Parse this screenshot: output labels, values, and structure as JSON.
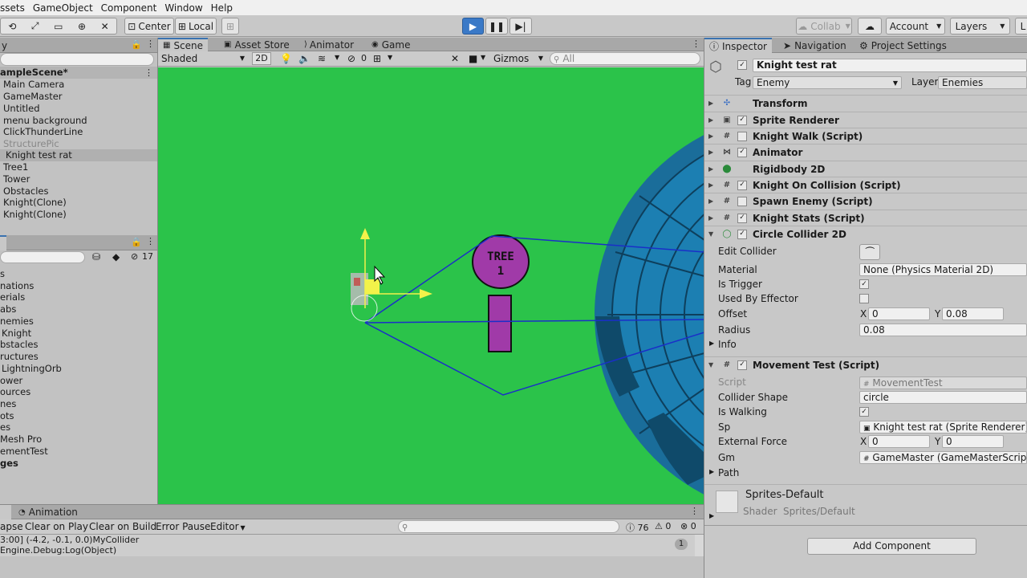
{
  "menubar": [
    "ssets",
    "GameObject",
    "Component",
    "Window",
    "Help"
  ],
  "toolbar": {
    "pivot": "Center",
    "space": "Local",
    "collab": "Collab",
    "account": "Account",
    "layers": "Layers",
    "layout": "L"
  },
  "hierarchy": {
    "tab_title": "y",
    "scene": "ampleScene*",
    "items": [
      "Main Camera",
      "GameMaster",
      "Untitled",
      "menu background",
      "ClickThunderLine",
      "StructurePic",
      "Knight test rat",
      "Tree1",
      "Tower",
      "Obstacles",
      "Knight(Clone)",
      "Knight(Clone)"
    ]
  },
  "project": {
    "count": "17",
    "items": [
      "s",
      "nations",
      "erials",
      "abs",
      "nemies",
      "Knight",
      "bstacles",
      "ructures",
      "LightningOrb",
      "ower",
      "ources",
      "nes",
      "ots",
      "es",
      "Mesh Pro",
      "ementTest",
      "ges"
    ]
  },
  "scene_view": {
    "tabs": [
      "Scene",
      "Asset Store",
      "Animator",
      "Game"
    ],
    "shading": "Shaded",
    "mode_2d": "2D",
    "hidden_count": "0",
    "gizmos": "Gizmos",
    "search_placeholder": "All",
    "tree_label_1": "TREE",
    "tree_label_2": "1",
    "background_color": "#2bc34a"
  },
  "console": {
    "tab": "Animation",
    "buttons": [
      "apse",
      "Clear on Play",
      "Clear on Build",
      "Error Pause",
      "Editor"
    ],
    "log_count": "76",
    "warn_count": "0",
    "error_count": "0",
    "line1": "3:00] (-4.2, -0.1, 0.0)MyCollider",
    "line2": "Engine.Debug:Log(Object)",
    "collapse_count": "1"
  },
  "inspector": {
    "tabs": [
      "Inspector",
      "Navigation",
      "Project Settings"
    ],
    "object_name": "Knight test rat",
    "tag_label": "Tag",
    "tag_value": "Enemy",
    "layer_label": "Layer",
    "layer_value": "Enemies",
    "components": [
      {
        "name": "Transform",
        "checkbox": "none"
      },
      {
        "name": "Sprite Renderer",
        "checkbox": "on"
      },
      {
        "name": "Knight Walk (Script)",
        "checkbox": "off"
      },
      {
        "name": "Animator",
        "checkbox": "on"
      },
      {
        "name": "Rigidbody 2D",
        "checkbox": "none"
      },
      {
        "name": "Knight On Collision (Script)",
        "checkbox": "on"
      },
      {
        "name": "Spawn Enemy (Script)",
        "checkbox": "off"
      },
      {
        "name": "Knight Stats (Script)",
        "checkbox": "on"
      },
      {
        "name": "Circle Collider 2D",
        "checkbox": "on"
      }
    ],
    "collider": {
      "edit_label": "Edit Collider",
      "material_label": "Material",
      "material_value": "None (Physics Material 2D)",
      "trigger_label": "Is Trigger",
      "effector_label": "Used By Effector",
      "offset_label": "Offset",
      "offset_x": "0",
      "offset_y": "0.08",
      "radius_label": "Radius",
      "radius_value": "0.08",
      "info_label": "Info"
    },
    "movement": {
      "name": "Movement Test (Script)",
      "script_label": "Script",
      "script_value": "MovementTest",
      "shape_label": "Collider Shape",
      "shape_value": "circle",
      "walking_label": "Is Walking",
      "sp_label": "Sp",
      "sp_value": "Knight test rat (Sprite Renderer)",
      "force_label": "External Force",
      "force_x": "0",
      "force_y": "0",
      "gm_label": "Gm",
      "gm_value": "GameMaster (GameMasterScript)",
      "path_label": "Path"
    },
    "material": {
      "name": "Sprites-Default",
      "shader_label": "Shader",
      "shader_value": "Sprites/Default"
    },
    "add_component": "Add Component",
    "x_label": "X",
    "y_label": "Y"
  }
}
